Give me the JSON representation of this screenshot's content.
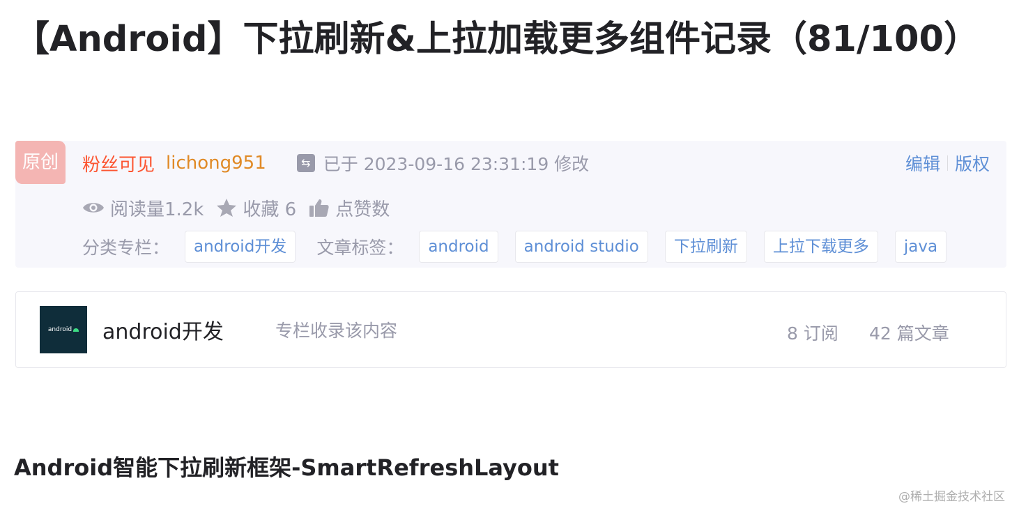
{
  "article": {
    "title": "【Android】下拉刷新&上拉加载更多组件记录（81/100）"
  },
  "meta": {
    "original_badge": "原创",
    "visibility": "粉丝可见",
    "author": "lichong951",
    "updated_text": "已于 2023-09-16 23:31:19 修改",
    "edit_link": "编辑",
    "copyright_link": "版权",
    "views": "阅读量1.2k",
    "favorites": "收藏 6",
    "likes": "点赞数",
    "category_label": "分类专栏：",
    "categories": [
      "android开发"
    ],
    "tags_label": "文章标签：",
    "tags": [
      "android",
      "android studio",
      "下拉刷新",
      "上拉下载更多",
      "java"
    ]
  },
  "column": {
    "thumb_text": "android",
    "name": "android开发",
    "description": "专栏收录该内容",
    "subscribers": "8 订阅",
    "articles": "42 篇文章"
  },
  "content": {
    "heading": "Android智能下拉刷新框架-SmartRefreshLayout"
  },
  "watermark": "@稀土掘金技术社区"
}
